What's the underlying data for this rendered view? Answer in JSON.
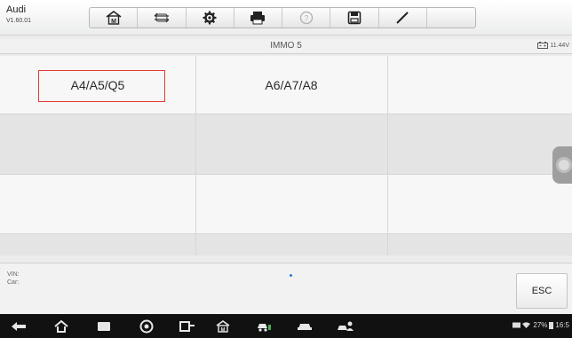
{
  "app": {
    "name": "Audi",
    "version": "V1.60.01"
  },
  "toolbar": {
    "icons": [
      "home-icon",
      "vehicle-swap-icon",
      "settings-icon",
      "print-icon",
      "help-icon",
      "save-icon",
      "edit-icon"
    ]
  },
  "screen": {
    "title": "IMMO 5",
    "battery_voltage": "11.44V"
  },
  "menu": {
    "items": [
      "A4/A5/Q5",
      "A6/A7/A8"
    ],
    "selected_index": 0
  },
  "footer": {
    "vin_label": "VIN:",
    "car_label": "Car:",
    "esc_label": "ESC"
  },
  "status_bar": {
    "battery": "27%",
    "time": "16:5"
  },
  "colors": {
    "highlight": "#e53935",
    "page_dot": "#2979d8"
  }
}
